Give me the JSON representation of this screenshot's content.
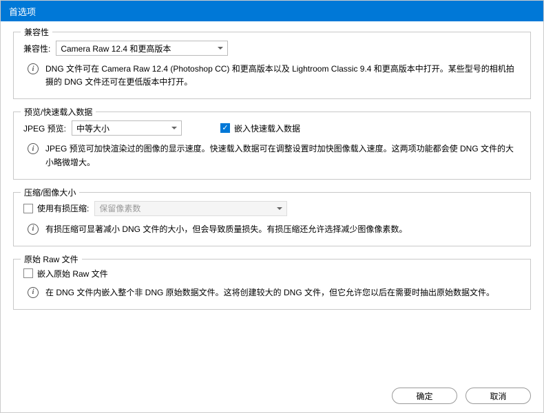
{
  "window": {
    "title": "首选项"
  },
  "compat": {
    "legend": "兼容性",
    "label": "兼容性:",
    "value": "Camera Raw 12.4 和更高版本",
    "info": "DNG 文件可在 Camera Raw 12.4 (Photoshop CC) 和更高版本以及 Lightroom Classic 9.4 和更高版本中打开。某些型号的相机拍摄的 DNG 文件还可在更低版本中打开。"
  },
  "preview": {
    "legend": "预览/快速载入数据",
    "jpeg_label": "JPEG 预览:",
    "jpeg_value": "中等大小",
    "embed_label": "嵌入快速载入数据",
    "info": "JPEG 预览可加快渲染过的图像的显示速度。快速载入数据可在调整设置时加快图像载入速度。这两项功能都会使 DNG 文件的大小略微增大。"
  },
  "compress": {
    "legend": "压缩/图像大小",
    "lossy_label": "使用有损压缩:",
    "lossy_value": "保留像素数",
    "info": "有损压缩可显著减小 DNG 文件的大小，但会导致质量损失。有损压缩还允许选择减少图像像素数。"
  },
  "raw": {
    "legend": "原始 Raw 文件",
    "embed_label": "嵌入原始 Raw 文件",
    "info": "在 DNG 文件内嵌入整个非 DNG 原始数据文件。这将创建较大的 DNG 文件，但它允许您以后在需要时抽出原始数据文件。"
  },
  "buttons": {
    "ok": "确定",
    "cancel": "取消"
  }
}
